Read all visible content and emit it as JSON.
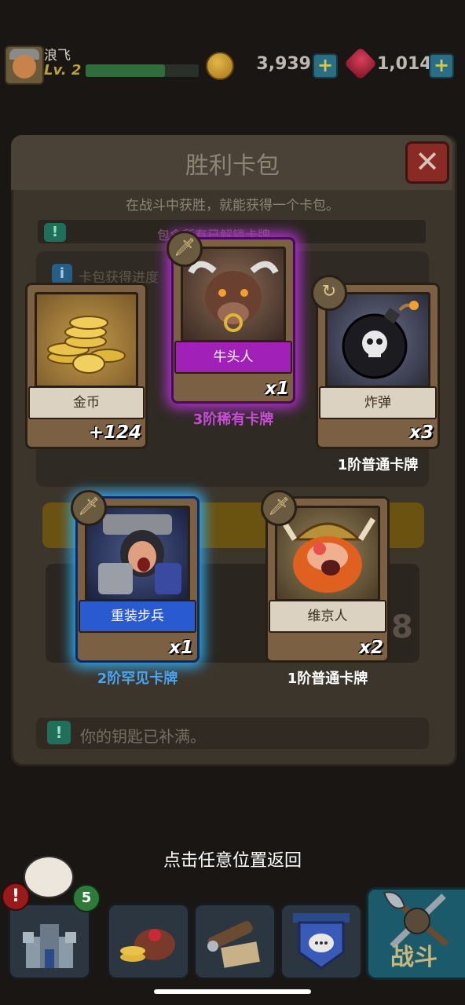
{
  "player": {
    "name": "浪飞",
    "level": "Lv. 2",
    "xp_fraction": 0.7
  },
  "currency": {
    "coins": "3,939",
    "gems": "1,014"
  },
  "dialog": {
    "title": "胜利卡包",
    "subtitle": "在战斗中获胜，就能获得一个卡包。",
    "info_text": "包含所有已解锁卡牌。",
    "progress_label": "卡包获得进度",
    "slot_count": "8",
    "keys_full_text": "你的钥匙已补满。"
  },
  "cards": [
    {
      "name": "金币",
      "quantity": "+124",
      "rarity": "",
      "style": "plain",
      "icon": "coin-pile-icon"
    },
    {
      "name": "牛头人",
      "quantity": "x1",
      "rarity": "3阶稀有卡牌",
      "style": "purple",
      "icon": "sword-icon",
      "rarity_color": "#c84cd8"
    },
    {
      "name": "炸弹",
      "quantity": "x3",
      "rarity": "1阶普通卡牌",
      "style": "plain",
      "icon": "spell-swirl-icon",
      "rarity_color": "#ffffff"
    },
    {
      "name": "重装步兵",
      "quantity": "x1",
      "rarity": "2阶罕见卡牌",
      "style": "blue",
      "icon": "sword-icon",
      "rarity_color": "#4aa3f0"
    },
    {
      "name": "维京人",
      "quantity": "x2",
      "rarity": "1阶普通卡牌",
      "style": "plain",
      "icon": "sword-icon",
      "rarity_color": "#ffffff"
    }
  ],
  "prompt": "点击任意位置返回",
  "nav": {
    "alert_badge": "!",
    "notification_count": "5",
    "fight_label": "战斗",
    "items": [
      "castle-icon",
      "treasure-icon",
      "telescope-map-icon",
      "clan-chat-icon",
      "battle-axes-icon"
    ]
  }
}
